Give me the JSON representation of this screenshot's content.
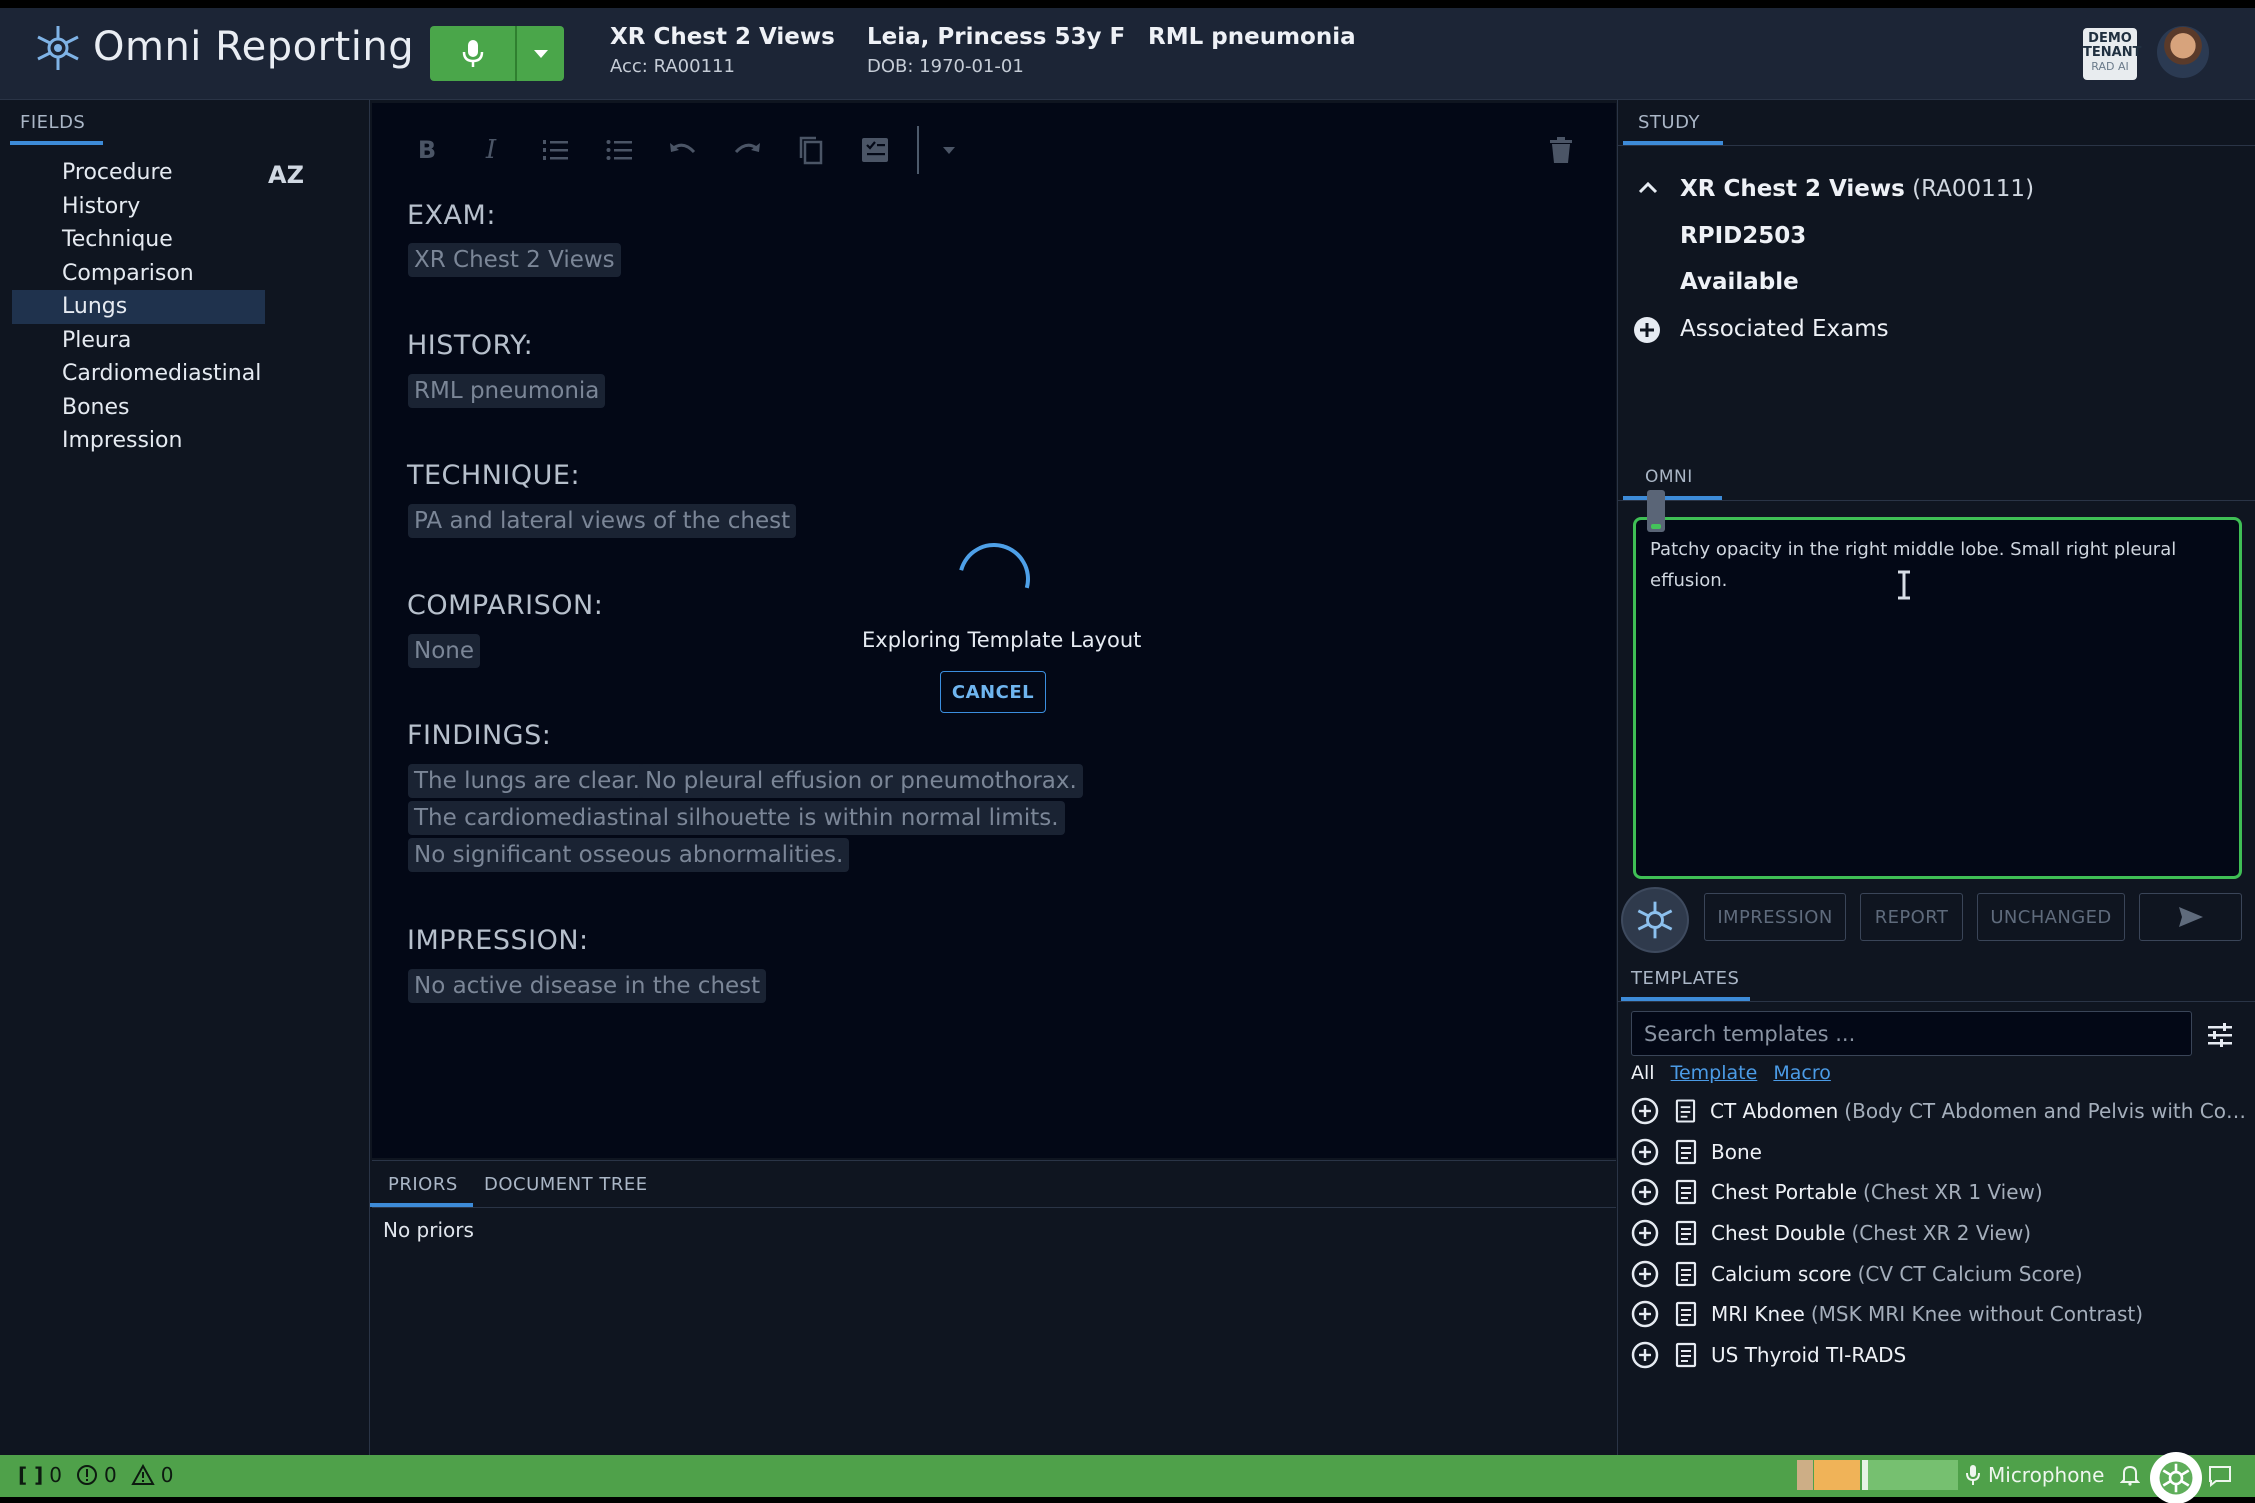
{
  "header": {
    "app_title": "Omni Reporting",
    "exam_title": "XR Chest 2 Views",
    "accession": "Acc: RA00111",
    "patient_name": "Leia, Princess 53y F",
    "dob": "DOB: 1970-01-01",
    "history": "RML pneumonia",
    "tenant_badge": [
      "DEMO",
      "TENANT",
      "RAD AI"
    ]
  },
  "fields_panel": {
    "tab_label": "FIELDS",
    "sort_label": "AZ",
    "items": [
      "Procedure",
      "History",
      "Technique",
      "Comparison",
      "Lungs",
      "Pleura",
      "Cardiomediastinal",
      "Bones",
      "Impression"
    ],
    "active_item": "Lungs"
  },
  "editor": {
    "sections": {
      "exam": {
        "heading": "EXAM:",
        "chips": [
          "XR Chest 2 Views"
        ]
      },
      "history": {
        "heading": "HISTORY:",
        "chips": [
          "RML pneumonia"
        ]
      },
      "technique": {
        "heading": "TECHNIQUE:",
        "chips": [
          "PA and lateral views of the chest"
        ]
      },
      "comparison": {
        "heading": "COMPARISON:",
        "chips": [
          "None"
        ]
      },
      "findings": {
        "heading": "FINDINGS:",
        "chips": [
          "The lungs are clear.",
          "No pleural effusion or pneumothorax.",
          "The cardiomediastinal silhouette is within normal limits.",
          "No significant osseous abnormalities."
        ]
      },
      "impression": {
        "heading": "IMPRESSION:",
        "chips": [
          "No active disease in the chest"
        ]
      }
    },
    "loading": {
      "text": "Exploring Template Layout",
      "cancel_label": "CANCEL"
    }
  },
  "priors_panel": {
    "tabs": [
      "PRIORS",
      "DOCUMENT TREE"
    ],
    "active_tab": "PRIORS",
    "empty_text": "No priors"
  },
  "study_panel": {
    "tab_label": "STUDY",
    "exam_name": "XR Chest 2 Views",
    "exam_accession": "(RA00111)",
    "rpid": "RPID2503",
    "status": "Available",
    "associated_exams_label": "Associated Exams"
  },
  "omni_panel": {
    "tab_label": "OMNI",
    "input_text": "Patchy opacity in the right middle lobe. Small right pleural effusion.",
    "actions": [
      "IMPRESSION",
      "REPORT",
      "UNCHANGED"
    ]
  },
  "templates_panel": {
    "tab_label": "TEMPLATES",
    "search_placeholder": "Search templates ...",
    "filters": {
      "all": "All",
      "template": "Template",
      "macro": "Macro"
    },
    "items": [
      {
        "name": "CT Abdomen",
        "desc": "(Body CT Abdomen and Pelvis with Cont..."
      },
      {
        "name": "Bone",
        "desc": ""
      },
      {
        "name": "Chest Portable",
        "desc": "(Chest XR 1 View)"
      },
      {
        "name": "Chest Double",
        "desc": "(Chest XR 2 View)"
      },
      {
        "name": "Calcium score",
        "desc": "(CV CT Calcium Score)"
      },
      {
        "name": "MRI Knee",
        "desc": "(MSK MRI Knee without Contrast)"
      },
      {
        "name": "US Thyroid TI-RADS",
        "desc": ""
      }
    ]
  },
  "status_bar": {
    "brackets_count": "0",
    "errors_count": "0",
    "warnings_count": "0",
    "microphone_label": "Microphone"
  },
  "colors": {
    "accent_blue": "#3d8bd8",
    "mic_green": "#4aa64a",
    "omni_border_green": "#3fbf55",
    "status_bar_green": "#4fa14a"
  }
}
